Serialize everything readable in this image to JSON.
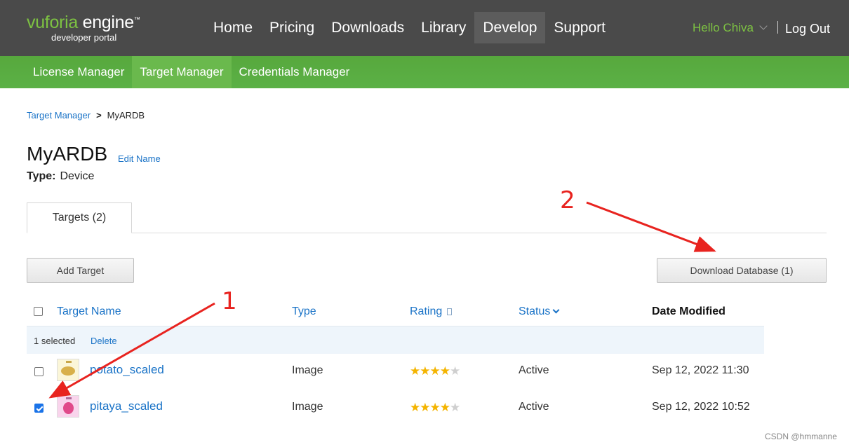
{
  "header": {
    "logo_brand": "vuforia",
    "logo_product": "engine",
    "logo_tm": "™",
    "logo_sub": "developer portal",
    "nav": [
      {
        "label": "Home",
        "active": false
      },
      {
        "label": "Pricing",
        "active": false
      },
      {
        "label": "Downloads",
        "active": false
      },
      {
        "label": "Library",
        "active": false
      },
      {
        "label": "Develop",
        "active": true
      },
      {
        "label": "Support",
        "active": false
      }
    ],
    "user_greeting": "Hello Chiva",
    "logout_label": "Log Out"
  },
  "subnav": [
    {
      "label": "License Manager",
      "active": false
    },
    {
      "label": "Target Manager",
      "active": true
    },
    {
      "label": "Credentials Manager",
      "active": false
    }
  ],
  "breadcrumb": {
    "parent": "Target Manager",
    "separator": ">",
    "current": "MyARDB"
  },
  "database": {
    "title": "MyARDB",
    "edit_name_label": "Edit Name",
    "type_label": "Type:",
    "type_value": "Device"
  },
  "tabs": [
    {
      "label": "Targets (2)",
      "active": true
    }
  ],
  "toolbar": {
    "add_target_label": "Add Target",
    "download_database_label": "Download Database (1)"
  },
  "table": {
    "headers": {
      "name": "Target Name",
      "type": "Type",
      "rating": "Rating",
      "status": "Status",
      "date": "Date Modified"
    },
    "header_checkbox_checked": false,
    "selection": {
      "count_text": "1 selected",
      "delete_label": "Delete"
    },
    "rows": [
      {
        "name": "potato_scaled",
        "type": "Image",
        "rating": 4,
        "rating_max": 5,
        "status": "Active",
        "date": "Sep 12, 2022 11:30",
        "checked": false,
        "thumb_icon": "potato-thumbnail"
      },
      {
        "name": "pitaya_scaled",
        "type": "Image",
        "rating": 4,
        "rating_max": 5,
        "status": "Active",
        "date": "Sep 12, 2022 10:52",
        "checked": true,
        "thumb_icon": "pitaya-thumbnail"
      }
    ]
  },
  "annotations": {
    "label_1": "1",
    "label_2": "2",
    "color": "#e8231f"
  },
  "watermark": "CSDN @hmmanne",
  "colors": {
    "header_bg": "#4a4a4a",
    "brand_green": "#7dc242",
    "subnav_green": "#5bb146",
    "link_blue": "#1a73c7",
    "star": "#f4b400"
  }
}
